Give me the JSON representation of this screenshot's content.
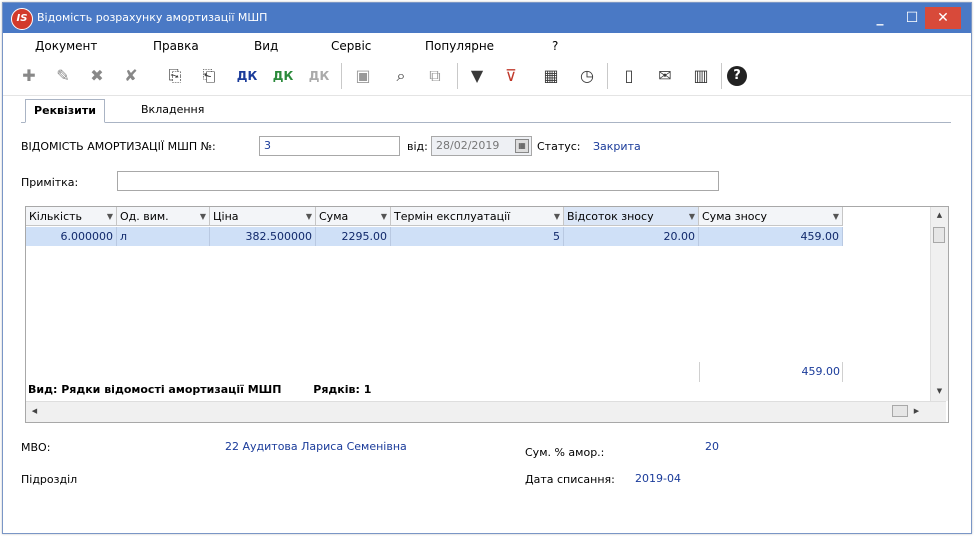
{
  "window": {
    "logo_text": "IS",
    "title": "Відомість розрахунку амортизації МШП",
    "minimize_glyph": "_",
    "maximize_glyph": "☐",
    "close_glyph": "✕"
  },
  "menu": [
    "Документ",
    "Правка",
    "Вид",
    "Сервіс",
    "Популярне",
    "?"
  ],
  "toolbar_icons": [
    "create-icon",
    "edit-icon",
    "delete-icon",
    "mark-delete-icon",
    "copy-icon",
    "paste-icon",
    "debit-credit-icon",
    "debit-credit-green-icon",
    "debit-credit-gray-icon",
    "save-icon",
    "search-icon",
    "find-replace-icon",
    "filter-icon",
    "clear-filter-icon",
    "table-icon",
    "history-icon",
    "document-icon",
    "mail-icon",
    "books-icon",
    "help-icon"
  ],
  "tabs": {
    "active": "Реквізити",
    "inactive": "Вкладення"
  },
  "form": {
    "doc_label": "ВІДОМІСТЬ АМОРТИЗАЦІЇ МШП №:",
    "doc_number": "3",
    "date_label": "від:",
    "date_value": "28/02/2019",
    "status_label": "Статус:",
    "status_value": "Закрита",
    "note_label": "Примітка:",
    "note_value": ""
  },
  "grid": {
    "columns": [
      "Кількість",
      "Од. вим.",
      "Ціна",
      "Сума",
      "Термін експлуатації",
      "Відсоток зносу",
      "Сума зносу"
    ],
    "rows": [
      [
        "6.000000",
        "л",
        "382.500000",
        "2295.00",
        "5",
        "20.00",
        "459.00"
      ]
    ],
    "total_wear": "459.00",
    "footer_view": "Вид: Рядки відомості амортизації МШП",
    "footer_rows": "Рядків: 1"
  },
  "bottom": {
    "mvo_label": "МВО:",
    "mvo_value": "22 Аудитова Лариса Семенівна",
    "dept_label": "Підрозділ",
    "sum_pct_label": "Сум. % амор.:",
    "sum_pct_value": "20",
    "writeoff_label": "Дата списання:",
    "writeoff_value": "2019-04"
  },
  "colors": {
    "titlebar": "#4a79c5",
    "selected_row": "#cfe0f7",
    "value_text": "#1a3b9a"
  }
}
